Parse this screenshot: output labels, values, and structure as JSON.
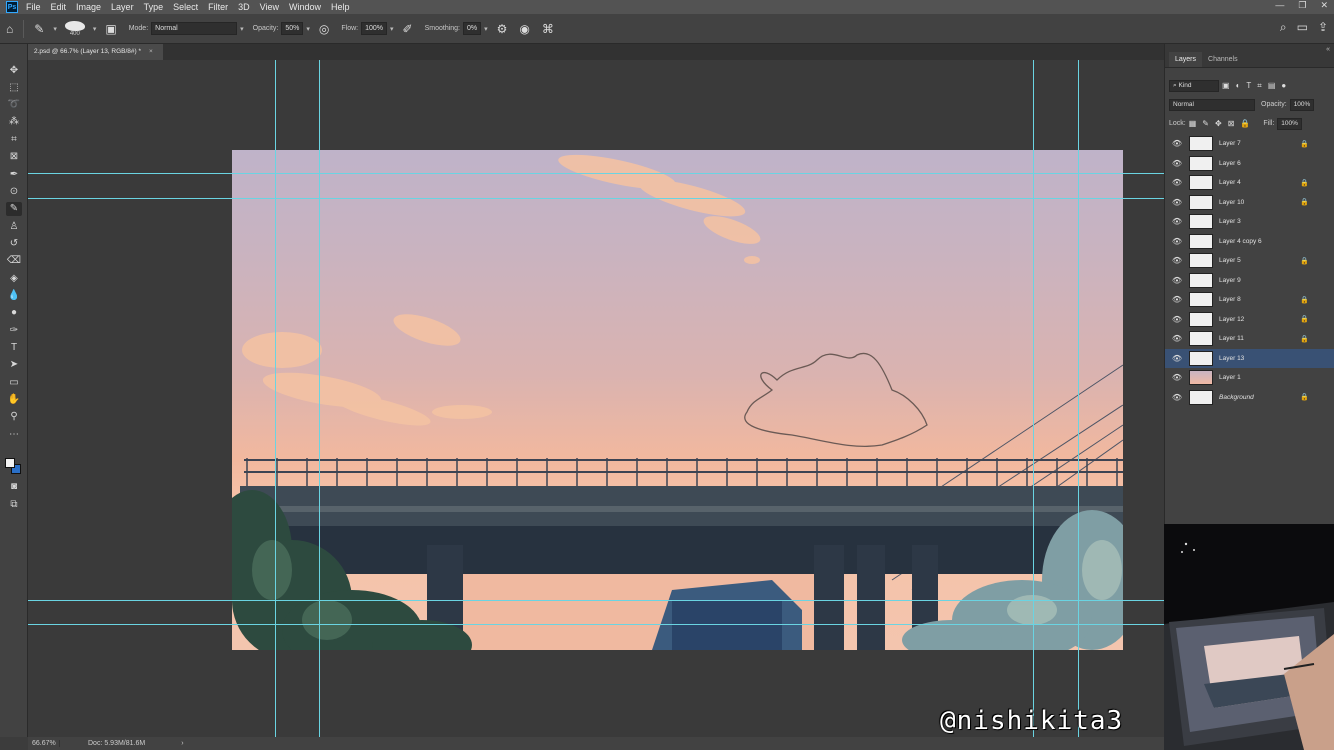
{
  "menu": {
    "app_logo": "Ps",
    "items": [
      "File",
      "Edit",
      "Image",
      "Layer",
      "Type",
      "Select",
      "Filter",
      "3D",
      "View",
      "Window",
      "Help"
    ]
  },
  "options": {
    "brush_size": "400",
    "mode_label": "Mode:",
    "mode_value": "Normal",
    "opacity_label": "Opacity:",
    "opacity_value": "50%",
    "flow_label": "Flow:",
    "flow_value": "100%",
    "smoothing_label": "Smoothing:",
    "smoothing_value": "0%"
  },
  "document": {
    "tab_title": "2.psd @ 66.7% (Layer 13, RGB/8#) *"
  },
  "status": {
    "zoom": "66.67%",
    "doc_size": "Doc: 5.93M/81.6M",
    "arrow": "›"
  },
  "layers_panel": {
    "tabs": [
      "Layers",
      "Channels"
    ],
    "filter_kind": "Kind",
    "blend_mode": "Normal",
    "opacity_label": "Opacity:",
    "opacity_value": "100%",
    "lock_label": "Lock:",
    "fill_label": "Fill:",
    "fill_value": "100%",
    "layers": [
      {
        "name": "Layer 7",
        "locked": true,
        "selected": false
      },
      {
        "name": "Layer 6",
        "locked": false,
        "selected": false
      },
      {
        "name": "Layer 4",
        "locked": true,
        "selected": false
      },
      {
        "name": "Layer 10",
        "locked": true,
        "selected": false
      },
      {
        "name": "Layer 3",
        "locked": false,
        "selected": false
      },
      {
        "name": "Layer 4 copy 6",
        "locked": false,
        "selected": false
      },
      {
        "name": "Layer 5",
        "locked": true,
        "selected": false
      },
      {
        "name": "Layer 9",
        "locked": false,
        "selected": false
      },
      {
        "name": "Layer 8",
        "locked": true,
        "selected": false
      },
      {
        "name": "Layer 12",
        "locked": true,
        "selected": false
      },
      {
        "name": "Layer 11",
        "locked": true,
        "selected": false
      },
      {
        "name": "Layer 13",
        "locked": false,
        "selected": true
      },
      {
        "name": "Layer 1",
        "locked": false,
        "selected": false
      },
      {
        "name": "Background",
        "locked": true,
        "selected": false
      }
    ]
  },
  "watermark": "@nishikita3",
  "colors": {
    "guide": "#6ad4e2",
    "selected_layer": "#395174",
    "background_swatch": "#2a6fc7"
  }
}
